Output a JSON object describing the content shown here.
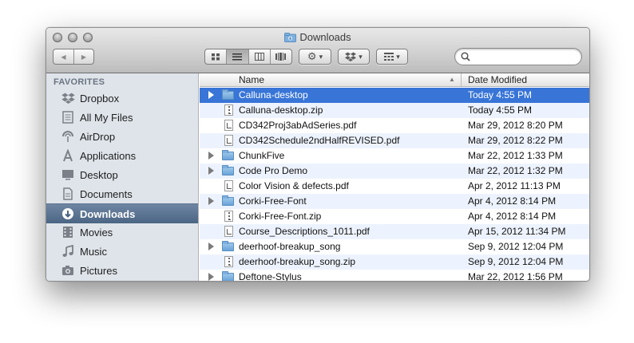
{
  "window": {
    "title": "Downloads"
  },
  "toolbar": {
    "back_glyph": "◀",
    "forward_glyph": "▶",
    "view_modes": [
      "icon-view",
      "list-view",
      "column-view",
      "coverflow-view"
    ],
    "action_glyph": "⚙",
    "dropdown_glyph": "▾",
    "search_placeholder": ""
  },
  "sidebar": {
    "heading": "FAVORITES",
    "items": [
      {
        "label": "Dropbox",
        "icon": "dropbox-icon",
        "selected": false
      },
      {
        "label": "All My Files",
        "icon": "all-files-icon",
        "selected": false
      },
      {
        "label": "AirDrop",
        "icon": "airdrop-icon",
        "selected": false
      },
      {
        "label": "Applications",
        "icon": "applications-icon",
        "selected": false
      },
      {
        "label": "Desktop",
        "icon": "desktop-icon",
        "selected": false
      },
      {
        "label": "Documents",
        "icon": "documents-icon",
        "selected": false
      },
      {
        "label": "Downloads",
        "icon": "downloads-icon",
        "selected": true
      },
      {
        "label": "Movies",
        "icon": "movies-icon",
        "selected": false
      },
      {
        "label": "Music",
        "icon": "music-icon",
        "selected": false
      },
      {
        "label": "Pictures",
        "icon": "pictures-icon",
        "selected": false
      }
    ]
  },
  "list": {
    "columns": {
      "name": "Name",
      "date": "Date Modified"
    },
    "rows": [
      {
        "name": "Calluna-desktop",
        "date": "Today 4:55 PM",
        "kind": "folder",
        "selected": true
      },
      {
        "name": "Calluna-desktop.zip",
        "date": "Today 4:55 PM",
        "kind": "zip"
      },
      {
        "name": "CD342Proj3abAdSeries.pdf",
        "date": "Mar 29, 2012 8:20 PM",
        "kind": "pdf"
      },
      {
        "name": "CD342Schedule2ndHalfREVISED.pdf",
        "date": "Mar 29, 2012 8:22 PM",
        "kind": "pdf"
      },
      {
        "name": "ChunkFive",
        "date": "Mar 22, 2012 1:33 PM",
        "kind": "folder"
      },
      {
        "name": "Code Pro Demo",
        "date": "Mar 22, 2012 1:32 PM",
        "kind": "folder"
      },
      {
        "name": "Color Vision & defects.pdf",
        "date": "Apr 2, 2012 11:13 PM",
        "kind": "pdf"
      },
      {
        "name": "Corki-Free-Font",
        "date": "Apr 4, 2012 8:14 PM",
        "kind": "folder"
      },
      {
        "name": "Corki-Free-Font.zip",
        "date": "Apr 4, 2012 8:14 PM",
        "kind": "zip"
      },
      {
        "name": "Course_Descriptions_1011.pdf",
        "date": "Apr 15, 2012 11:34 PM",
        "kind": "pdf"
      },
      {
        "name": "deerhoof-breakup_song",
        "date": "Sep 9, 2012 12:04 PM",
        "kind": "folder"
      },
      {
        "name": "deerhoof-breakup_song.zip",
        "date": "Sep 9, 2012 12:04 PM",
        "kind": "zip"
      },
      {
        "name": "Deftone-Stylus",
        "date": "Mar 22, 2012 1:56 PM",
        "kind": "folder"
      }
    ]
  }
}
